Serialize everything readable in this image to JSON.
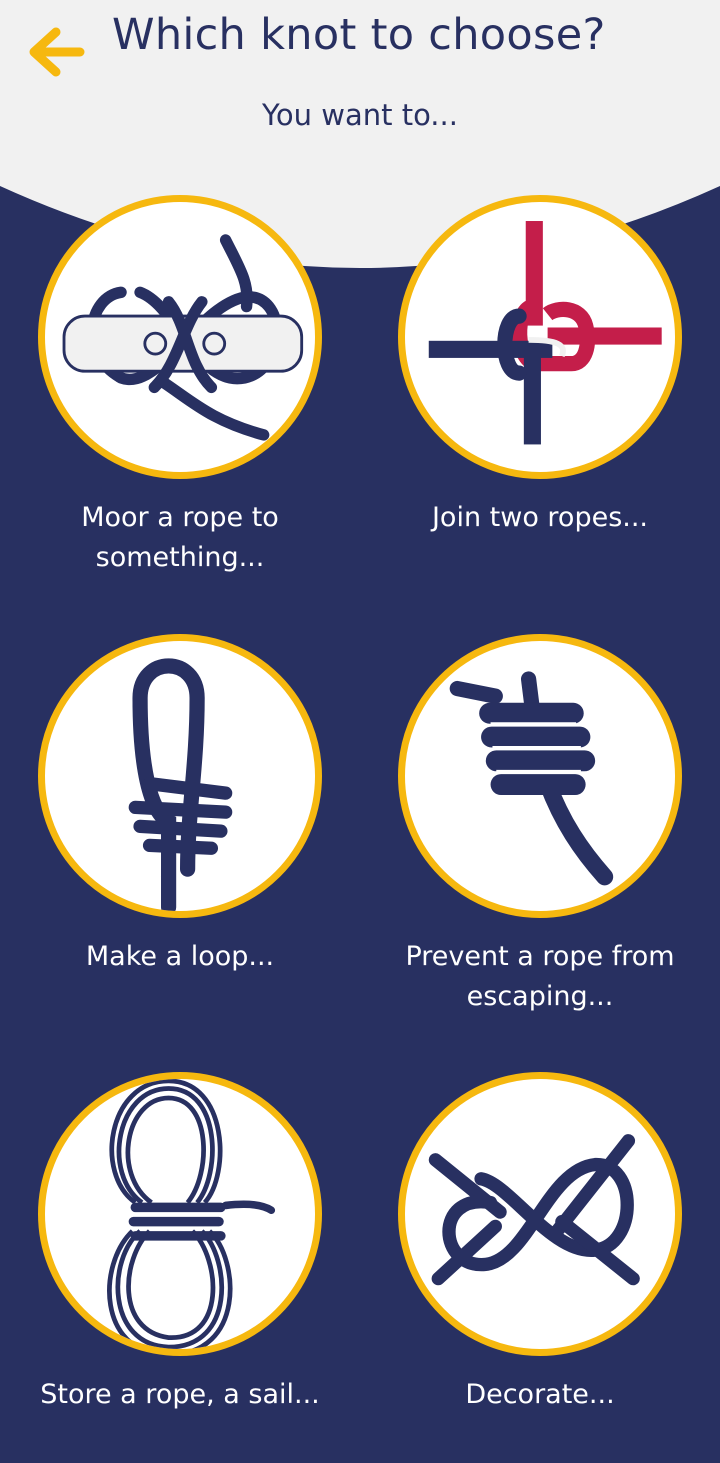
{
  "header": {
    "title": "Which knot to choose?",
    "subtitle": "You want to...",
    "back_icon": "arrow-left-icon",
    "accent_color": "#f6b80f"
  },
  "colors": {
    "background": "#283061",
    "header_background": "#f1f1f1",
    "circle_border": "#f6b80f",
    "rope": "#283061",
    "rope_red": "#c41e4a"
  },
  "options": [
    {
      "label": "Moor a rope to something...",
      "icon": "mooring-cleat-knot-icon"
    },
    {
      "label": "Join two ropes...",
      "icon": "joining-knot-icon"
    },
    {
      "label": "Make a loop...",
      "icon": "loop-knot-icon"
    },
    {
      "label": "Prevent a rope from escaping...",
      "icon": "stopper-knot-icon"
    },
    {
      "label": "Store a rope, a sail...",
      "icon": "coiled-rope-icon"
    },
    {
      "label": "Decorate...",
      "icon": "decorative-knot-icon"
    }
  ]
}
